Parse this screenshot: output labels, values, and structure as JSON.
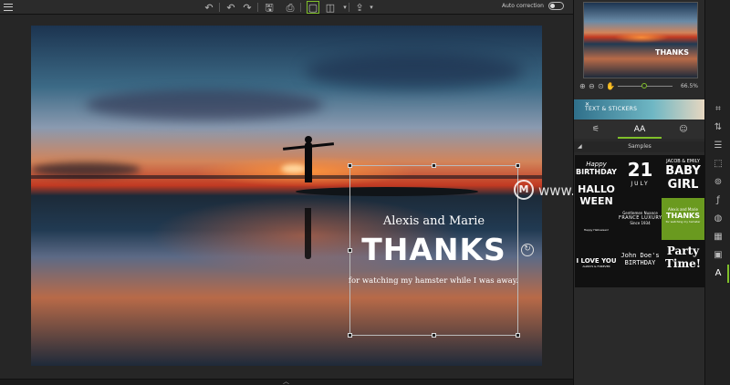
{
  "toolbar": {
    "auto_correction_label": "Auto correction",
    "icons": [
      "menu-icon",
      "undo-icon",
      "undo-step-icon",
      "redo-icon",
      "save-icon",
      "print-icon",
      "single-view-icon",
      "split-view-icon",
      "share-icon"
    ]
  },
  "canvas": {
    "text_line1": "Alexis and Marie",
    "text_line2": "THANKS",
    "text_line3": "for watching my hamster while I was away."
  },
  "panel": {
    "thumbnail_text": "THANKS",
    "zoom_level": "66.5%",
    "banner_label": "TEXT & STICKERS",
    "tabs": [
      "adjustments-tab",
      "text-tab",
      "stickers-tab"
    ],
    "tab_labels": [
      "⚟",
      "AA",
      "☺"
    ],
    "samples_label": "Samples",
    "samples": [
      {
        "lines": [
          "Happy",
          "BIRTHDAY",
          "HALLO",
          "WEEN"
        ]
      },
      {
        "lines": [
          "21",
          "JULY"
        ]
      },
      {
        "lines": [
          "JACOB & EMILY",
          "BABY",
          "GIRL"
        ]
      },
      {
        "lines": [
          "Gentlemen Nuance",
          "FRANCE LUXURY",
          "Since 1934"
        ]
      },
      {
        "lines": [
          "Alexis and Marie",
          "THANKS",
          "for watching my hamster"
        ]
      },
      {
        "lines": [
          "I LOVE YOU",
          "ALWAYS & FOREVER"
        ]
      },
      {
        "lines": [
          "John Doe's",
          "BIRTHDAY"
        ]
      },
      {
        "lines": [
          "Party",
          "Time!"
        ]
      },
      {
        "lines": [
          "Happy Halloween!"
        ]
      }
    ]
  },
  "watermark": {
    "logo": "M",
    "text": "www.MacDown.com"
  },
  "colors": {
    "accent": "#7fbf2a",
    "thanks_sample_bg": "#6a9a1f"
  }
}
